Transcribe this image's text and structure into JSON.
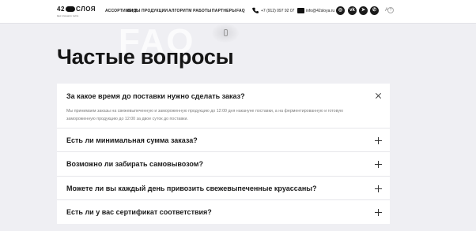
{
  "header": {
    "logo": {
      "number": "42",
      "word": "СЛОЯ",
      "tagline": "Цех слоеного теста"
    },
    "nav": [
      "АССОРТИМЕНТ",
      "ВИДЫ ПРОДУКЦИИ",
      "АЛГОРИТМ РАБОТЫ",
      "ПАРТНЕРЫ",
      "FAQ"
    ],
    "phone": "+7 (912) 097 92 07",
    "email": "info@42sloya.ru",
    "social": [
      "instagram-icon",
      "vk-icon",
      "telegram-icon",
      "whatsapp-icon"
    ],
    "lang": "A",
    "help": "?"
  },
  "hero": {
    "background_word": "FAQ",
    "title": "Частые вопросы"
  },
  "faq": [
    {
      "question": "За какое время до поставки нужно сделать заказ?",
      "answer": "Мы принимаем заказы на свежевыпеченную и замороженную продукцию до 12:00 дня накануне поставки, а на ферментированную и готовую замороженную продукцию до 12:00 за двое суток до поставки.",
      "open": true
    },
    {
      "question": "Есть ли минимальная сумма заказа?",
      "open": false
    },
    {
      "question": "Возможно ли забирать самовывозом?",
      "open": false
    },
    {
      "question": "Можете ли вы каждый день привозить свежевыпеченные круассаны?",
      "open": false
    },
    {
      "question": "Есть ли у вас сертификат соответствия?",
      "open": false
    }
  ],
  "colors": {
    "page_bg": "#efeff3",
    "card_bg": "#ffffff",
    "text": "#1a1a1a",
    "muted": "#7c7c7c"
  }
}
